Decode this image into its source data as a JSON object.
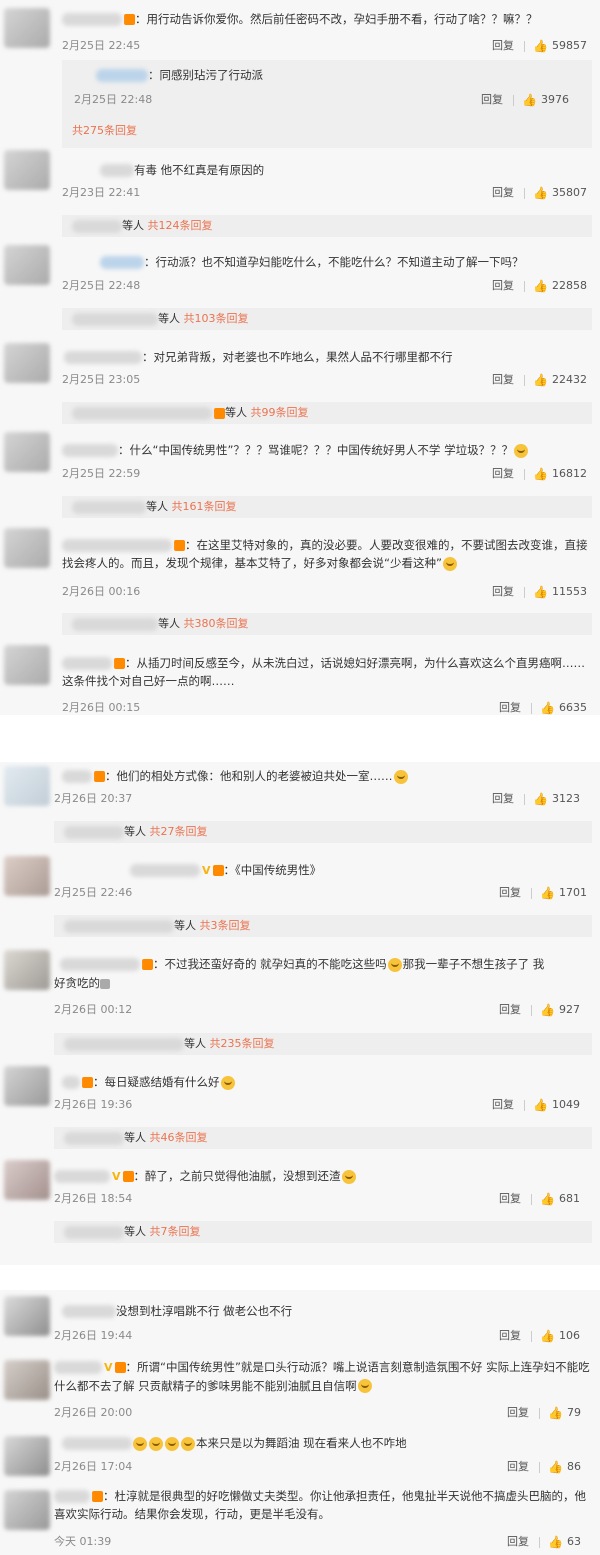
{
  "colors": {
    "accent": "#eb7350",
    "background": "#f2f2f2",
    "card": "#f7f7f7"
  },
  "ui": {
    "reply_label": "回复"
  },
  "comments": [
    {
      "text": "：用行动告诉你爱你。然后前任密码不改，孕妇手册不看，行动了啥？？嘛？？",
      "time": "2月25日 22:45",
      "likes": "59857"
    },
    {
      "text": "：同感别玷污了行动派",
      "time": "2月25日 22:48",
      "likes": "3976"
    },
    {
      "text": "有毒 他不红真是有原因的",
      "time": "2月23日 22:41",
      "likes": "35807"
    },
    {
      "text": "：行动派？也不知道孕妇能吃什么，不能吃什么？不知道主动了解一下吗？",
      "time": "2月25日 22:48",
      "likes": "22858"
    },
    {
      "text": "：对兄弟背叛，对老婆也不咋地么，果然人品不行哪里都不行",
      "time": "2月25日 23:05",
      "likes": "22432"
    },
    {
      "text": "：什么“中国传统男性”？？？骂谁呢？？？中国传统好男人不学 学垃圾？？？",
      "time": "2月25日 22:59",
      "likes": "16812"
    },
    {
      "text": "：在这里艾特对象的，真的没必要。人要改变很难的，不要试图去改变谁，直接找会疼人的。而且，发现个规律，基本艾特了，好多对象都会说“少看这种”",
      "time": "2月26日 00:16",
      "likes": "11553"
    },
    {
      "text": "：从插刀时间反感至今，从未洗白过，话说媳妇好漂亮啊，为什么喜欢这么个直男癌啊……这条件找个对自己好一点的啊……",
      "time": "2月26日 00:15",
      "likes": "6635"
    },
    {
      "text": "：他们的相处方式像：他和别人的老婆被迫共处一室……",
      "time": "2月26日 20:37",
      "likes": "3123"
    },
    {
      "text": "：《中国传统男性》",
      "time": "2月25日 22:46",
      "likes": "1701"
    },
    {
      "text": "：不过我还蛮好奇的 就孕妇真的不能吃这些吗",
      "text2": "那我一辈子不想生孩子了 我",
      "text3": "好贪吃的",
      "time": "2月26日 00:12",
      "likes": "927"
    },
    {
      "text": "：每日疑惑结婚有什么好",
      "time": "2月26日 19:36",
      "likes": "1049"
    },
    {
      "text": "：醉了，之前只觉得他油腻，没想到还渣",
      "time": "2月26日 18:54",
      "likes": "681"
    },
    {
      "text": "没想到杜淳唱跳不行 做老公也不行",
      "time": "2月26日 19:44",
      "likes": "106"
    },
    {
      "text": "：所谓“中国传统男性”就是口头行动派？嘴上说语言刻意制造氛围不好 实际上连孕妇不能吃什么都不去了解 只贡献精子的爹味男能不能别油腻且自信啊",
      "time": "2月26日 20:00",
      "likes": "79"
    },
    {
      "text": "本来只是以为舞蹈油 现在看来人也不咋地",
      "time": "2月26日 17:04",
      "likes": "86"
    },
    {
      "text": "：杜淳就是很典型的好吃懒做丈夫类型。你让他承担责任，他鬼扯半天说他不搞虚头巴脑的，他喜欢实际行动。结果你会发现，行动，更是半毛没有。",
      "time": "今天 01:39",
      "likes": "63"
    }
  ],
  "subs": [
    {
      "prefix": "",
      "count": "共275条回复"
    },
    {
      "prefix": "等人",
      "count": "共124条回复"
    },
    {
      "prefix": "等人",
      "count": "共103条回复"
    },
    {
      "prefix": "等人",
      "count": "共99条回复"
    },
    {
      "prefix": "等人",
      "count": "共161条回复"
    },
    {
      "prefix": "等人",
      "count": "共380条回复"
    },
    {
      "prefix": "等人",
      "count": "共27条回复"
    },
    {
      "prefix": "等人",
      "count": "共3条回复"
    },
    {
      "prefix": "等人",
      "count": "共235条回复"
    },
    {
      "prefix": "等人",
      "count": "共46条回复"
    },
    {
      "prefix": "等人",
      "count": "共7条回复"
    }
  ]
}
